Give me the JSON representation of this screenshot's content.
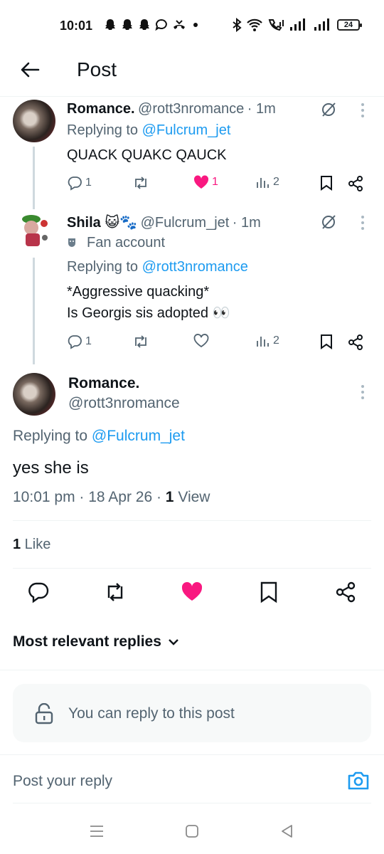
{
  "status_bar": {
    "time": "10:01",
    "battery": "24"
  },
  "header": {
    "title": "Post"
  },
  "thread": [
    {
      "name": "Romance.",
      "handle": "@rott3nromance",
      "time": "· 1m",
      "replying_prefix": "Replying to ",
      "replying_to": "@Fulcrum_jet",
      "text": "QUACK QUAKC QAUCK",
      "replies": "1",
      "reposts": "",
      "likes": "1",
      "views": "2",
      "liked": true
    },
    {
      "name": "Shila 😺🐾",
      "handle": "@Fulcrum_jet",
      "time": "· 1m",
      "label": "Fan account",
      "replying_prefix": "Replying to ",
      "replying_to": "@rott3nromance",
      "text_line1": "*Aggressive quacking*",
      "text_line2": "Is Georgis sis adopted 👀",
      "replies": "1",
      "reposts": "",
      "likes": "",
      "views": "2",
      "liked": false
    }
  ],
  "main_post": {
    "name": "Romance.",
    "handle": "@rott3nromance",
    "replying_prefix": "Replying to ",
    "replying_to": "@Fulcrum_jet",
    "text": "yes she is",
    "timestamp": "10:01 pm · 18 Apr 26 · ",
    "view_count": "1",
    "view_label": " View",
    "like_count": "1",
    "like_label": " Like"
  },
  "replies_sort": {
    "label": "Most relevant replies"
  },
  "reply_notice": {
    "text": "You can reply to this post"
  },
  "compose": {
    "placeholder": "Post your reply"
  },
  "colors": {
    "accent": "#1d9bf0",
    "like": "#f91880",
    "text": "#0f1419",
    "muted": "#536471"
  }
}
